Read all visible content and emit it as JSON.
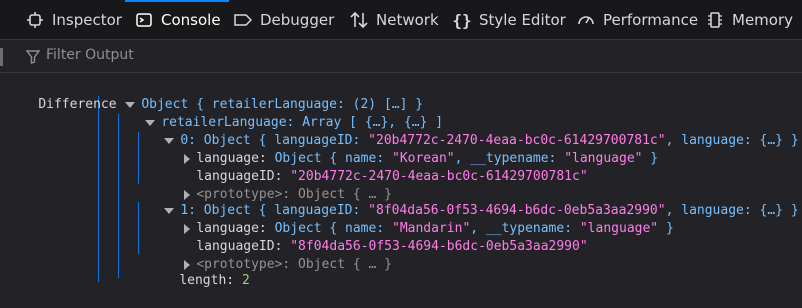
{
  "toolbar": {
    "tabs": [
      {
        "label": "Inspector",
        "icon": "inspector-icon"
      },
      {
        "label": "Console",
        "icon": "console-icon",
        "active": true
      },
      {
        "label": "Debugger",
        "icon": "debugger-icon"
      },
      {
        "label": "Network",
        "icon": "network-icon"
      },
      {
        "label": "Style Editor",
        "icon": "style-editor-icon"
      },
      {
        "label": "Performance",
        "icon": "performance-icon"
      },
      {
        "label": "Memory",
        "icon": "memory-icon"
      }
    ]
  },
  "filter": {
    "placeholder": "Filter Output",
    "icon": "filter-icon"
  },
  "console": {
    "label": "Difference",
    "root": "Object { retailerLanguage: (2) […] }",
    "array_key": "retailerLanguage: ",
    "array_val": "Array [ {…}, {…} ]",
    "items": [
      {
        "index": "0: ",
        "summary_obj": "Object { languageID: ",
        "summary_id": "\"20b4772c-2470-4eaa-bc0c-61429700781c\"",
        "summary_tail": ", language: {…} }",
        "language_key": "language: ",
        "language_obj": "Object { name: ",
        "language_name": "\"Korean\"",
        "typename_key": ", __typename: ",
        "typename_val": "\"language\"",
        "close": " }",
        "id_key": "languageID: ",
        "id_val": "\"20b4772c-2470-4eaa-bc0c-61429700781c\"",
        "prototype": "<prototype>: Object { … }"
      },
      {
        "index": "1: ",
        "summary_obj": "Object { languageID: ",
        "summary_id": "\"8f04da56-0f53-4694-b6dc-0eb5a3aa2990\"",
        "summary_tail": ", language: {…} }",
        "language_key": "language: ",
        "language_obj": "Object { name: ",
        "language_name": "\"Mandarin\"",
        "typename_key": ", __typename: ",
        "typename_val": "\"language\"",
        "close": " }",
        "id_key": "languageID: ",
        "id_val": "\"8f04da56-0f53-4694-b6dc-0eb5a3aa2990\"",
        "prototype": "<prototype>: Object { … }"
      }
    ],
    "length_key": "length: ",
    "length_val": "2"
  }
}
